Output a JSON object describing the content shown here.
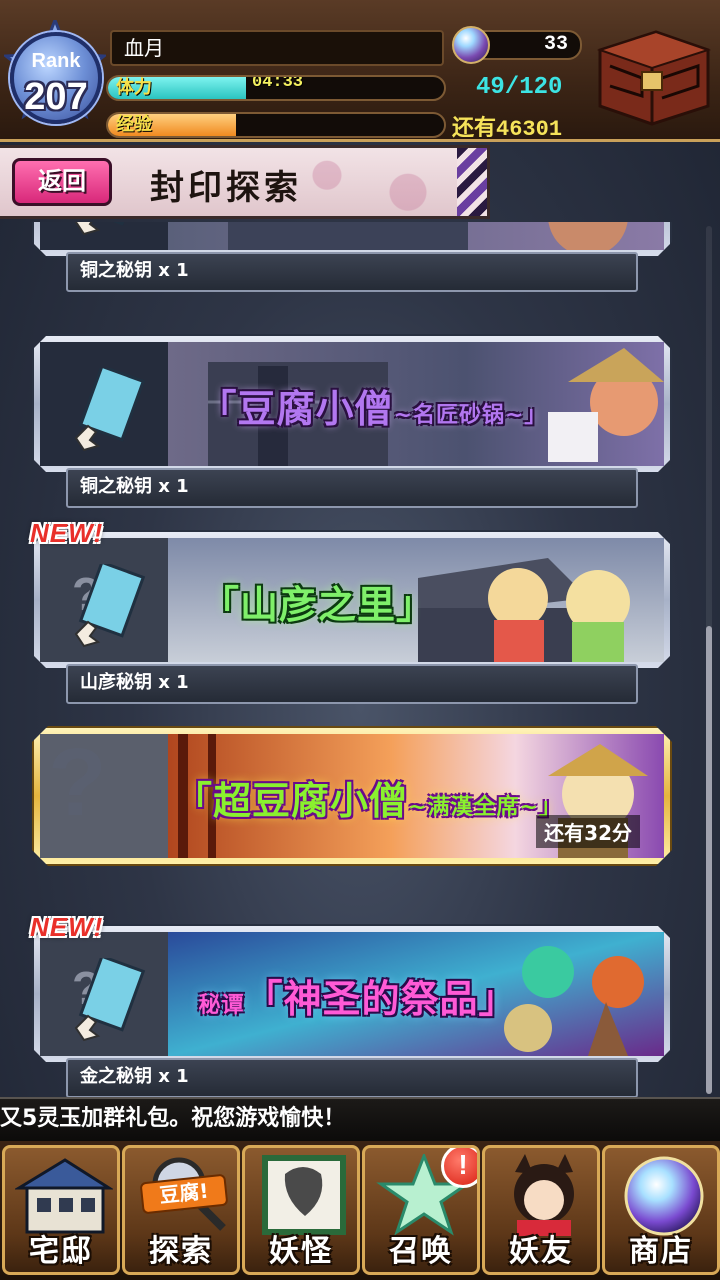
{
  "header": {
    "rank_label": "Rank",
    "rank_value": "207",
    "player_name": "血月",
    "stamina_label": "体力",
    "stamina_timer": "04:33",
    "stamina_fraction": 0.41,
    "stamina_value": "49/120",
    "exp_label": "经验",
    "exp_fraction": 0.38,
    "gems": "33",
    "remaining_label": "还有",
    "remaining_value": "46301"
  },
  "titlebar": {
    "back_label": "返回",
    "title": "封印探索"
  },
  "cards": [
    {
      "key_label": "铜之秘钥 x 1",
      "new": false,
      "locked": false,
      "banner": ""
    },
    {
      "key_label": "铜之秘钥 x 1",
      "new": false,
      "locked": false,
      "banner": "「豆腐小僧",
      "banner_sub": "~名匠砂锅~」"
    },
    {
      "key_label": "山彦秘钥 x 1",
      "new": true,
      "new_label": "NEW!",
      "locked": false,
      "banner": "「山彦之里」"
    },
    {
      "key_label": "",
      "new": false,
      "locked": true,
      "banner": "「超豆腐小僧",
      "banner_sub": "~满漢全席~」",
      "remaining": "还有32分"
    },
    {
      "key_label": "金之秘钥 x 1",
      "new": true,
      "new_label": "NEW!",
      "locked": false,
      "banner_prefix": "秘谭",
      "banner": "「神圣的祭品」"
    }
  ],
  "ticker": "又5灵玉加群礼包。祝您游戏愉快！",
  "nav": {
    "home": "宅邸",
    "search": "探索",
    "search_tag": "豆腐!",
    "youkai": "妖怪",
    "summon": "召唤",
    "summon_alert": "!",
    "friends": "妖友",
    "shop": "商店"
  },
  "colors": {
    "stamina": "#2ac4c0",
    "exp": "#f08a20",
    "back_button": "#d8287a",
    "new_badge": "#e9302a"
  }
}
